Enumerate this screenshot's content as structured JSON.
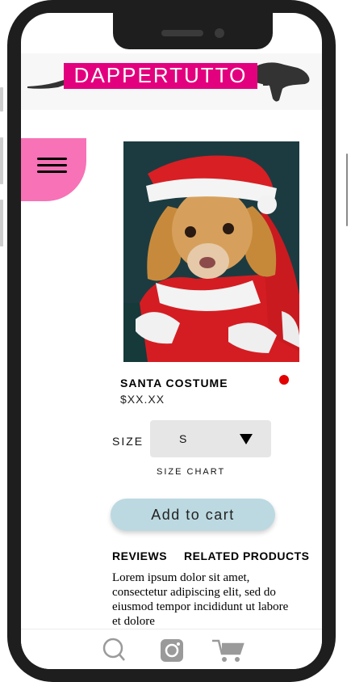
{
  "brand": {
    "name": "DAPPERTUTTO",
    "accent": "#e3007e"
  },
  "product": {
    "title": "SANTA COSTUME",
    "price": "$XX.XX",
    "color_swatch": "#e20000"
  },
  "size": {
    "label": "SIZE",
    "selected": "S",
    "chart_link": "SIZE CHART"
  },
  "actions": {
    "add_to_cart": "Add to cart"
  },
  "tabs": [
    {
      "label": "REVIEWS"
    },
    {
      "label": "RELATED PRODUCTS"
    }
  ],
  "description": "Lorem ipsum dolor sit amet, consectetur adipiscing elit, sed do eiusmod tempor incididunt ut labore et dolore",
  "nav": {
    "icons": [
      "search-icon",
      "instagram-icon",
      "cart-icon"
    ]
  },
  "colors": {
    "menu_button": "#f772b6",
    "add_to_cart": "#bcd9e1",
    "select_bg": "#e6e6e6"
  }
}
